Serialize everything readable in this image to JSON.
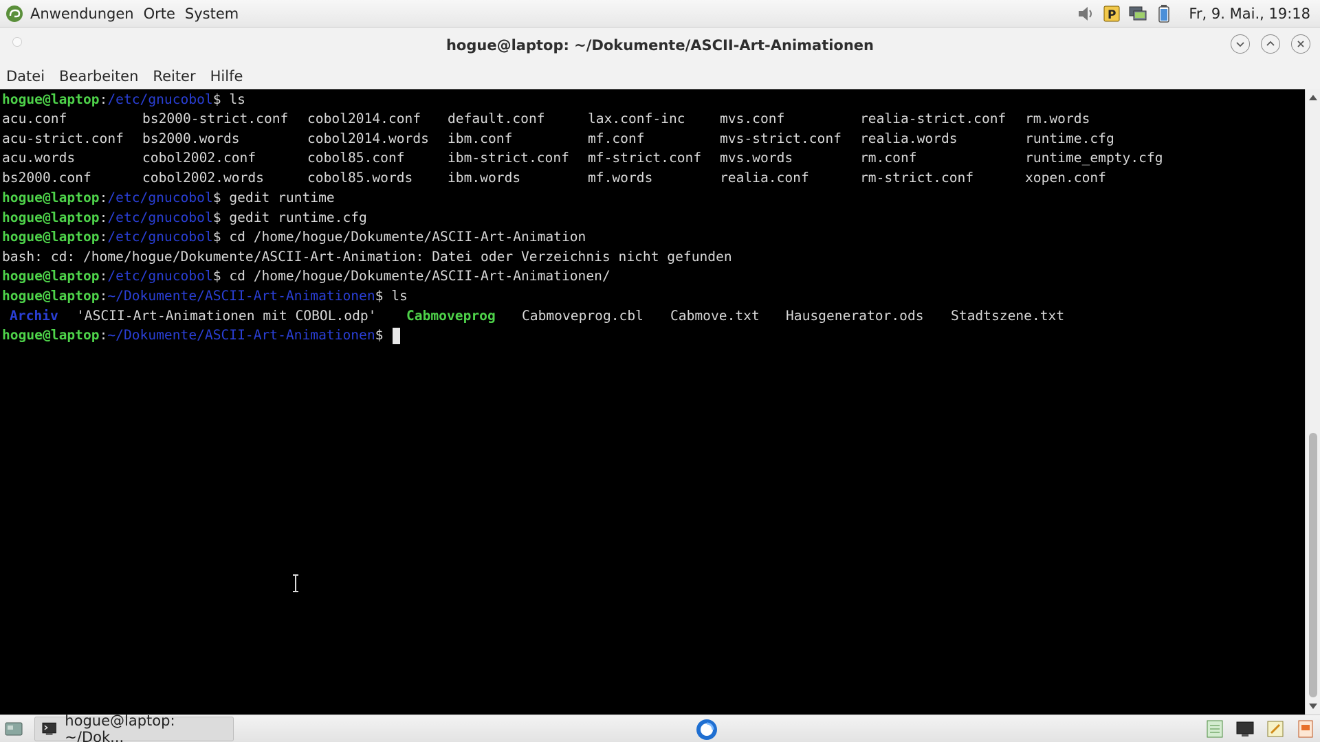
{
  "top_panel": {
    "menus": [
      "Anwendungen",
      "Orte",
      "System"
    ],
    "clock": "Fr, 9. Mai., 19:18",
    "tray_icons": [
      "volume-icon",
      "parking-app-icon",
      "network-icon",
      "battery-icon"
    ]
  },
  "window": {
    "title": "hogue@laptop: ~/Dokumente/ASCII-Art-Animationen",
    "controls": [
      "minimize",
      "maximize",
      "close"
    ]
  },
  "menubar": [
    "Datei",
    "Bearbeiten",
    "Reiter",
    "Hilfe"
  ],
  "terminal": {
    "prompt_user": "hogue@laptop",
    "path_etc": "/etc/gnucobol",
    "path_anim": "~/Dokumente/ASCII-Art-Animationen",
    "cmd_ls": "ls",
    "ls_columns": [
      [
        "acu.conf",
        "acu-strict.conf",
        "acu.words",
        "bs2000.conf"
      ],
      [
        "bs2000-strict.conf",
        "bs2000.words",
        "cobol2002.conf",
        "cobol2002.words"
      ],
      [
        "cobol2014.conf",
        "cobol2014.words",
        "cobol85.conf",
        "cobol85.words"
      ],
      [
        "default.conf",
        "ibm.conf",
        "ibm-strict.conf",
        "ibm.words"
      ],
      [
        "lax.conf-inc",
        "mf.conf",
        "mf-strict.conf",
        "mf.words"
      ],
      [
        "mvs.conf",
        "mvs-strict.conf",
        "mvs.words",
        "realia.conf"
      ],
      [
        "realia-strict.conf",
        "realia.words",
        "rm.conf",
        "rm-strict.conf"
      ],
      [
        "rm.words",
        "runtime.cfg",
        "runtime_empty.cfg",
        "xopen.conf"
      ]
    ],
    "cmd_gedit1": "gedit runtime",
    "cmd_gedit2": "gedit runtime.cfg",
    "cmd_cd1": "cd /home/hogue/Dokumente/ASCII-Art-Animation",
    "error_line": "bash: cd: /home/hogue/Dokumente/ASCII-Art-Animation: Datei oder Verzeichnis nicht gefunden",
    "cmd_cd2": "cd /home/hogue/Dokumente/ASCII-Art-Animationen/",
    "ls2_items": [
      {
        "name": "Archiv",
        "kind": "dir"
      },
      {
        "name": "'ASCII-Art-Animationen mit COBOL.odp'",
        "kind": "file"
      },
      {
        "name": "Cabmoveprog",
        "kind": "exe"
      },
      {
        "name": "Cabmoveprog.cbl",
        "kind": "file"
      },
      {
        "name": "Cabmove.txt",
        "kind": "file"
      },
      {
        "name": "Hausgenerator.ods",
        "kind": "file"
      },
      {
        "name": "Stadtszene.txt",
        "kind": "file"
      }
    ]
  },
  "taskbar": {
    "task_label": "hogue@laptop: ~/Dok..."
  },
  "colors": {
    "prompt_user": "#4ed34a",
    "prompt_path": "#2a3fd6",
    "terminal_bg": "#000000",
    "terminal_fg": "#d8d8d8"
  }
}
